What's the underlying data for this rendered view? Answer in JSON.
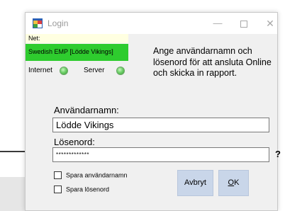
{
  "window": {
    "title": "Login",
    "controls": {
      "minimize": "—",
      "close": "✕"
    }
  },
  "network": {
    "label": "Net:",
    "selected": "Swedish EMP [Lödde Vikings]",
    "internet_label": "Internet",
    "server_label": "Server",
    "status_color": "#2ecc2e"
  },
  "info_text": "Ange användarnamn och lösenord för att ansluta Online och skicka in rapport.",
  "form": {
    "username_label": "Användarnamn:",
    "username_value": "Lödde Vikings",
    "password_label": "Lösenord:",
    "password_value": "*************",
    "help_label": "?",
    "remember_user_label": "Spara användarnamn",
    "remember_password_label": "Spara lösenord"
  },
  "buttons": {
    "cancel_label": "Avbryt",
    "ok_accel": "O",
    "ok_rest": "K"
  },
  "icons": {
    "app": "app-window-icon",
    "minimize": "minimize-icon",
    "maximize": "maximize-icon",
    "close": "close-icon",
    "led": "status-led-icon"
  }
}
